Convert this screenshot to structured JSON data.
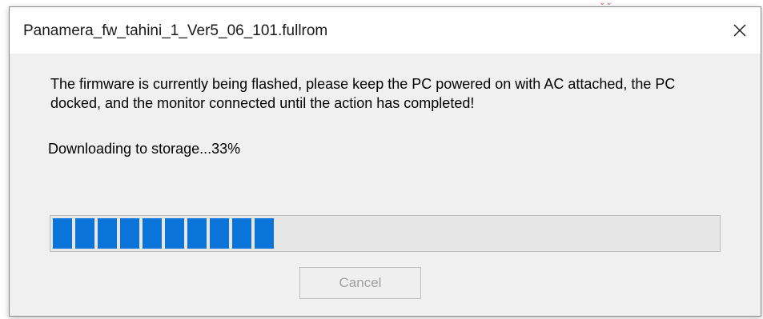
{
  "dialog": {
    "title": "Panamera_fw_tahini_1_Ver5_06_101.fullrom",
    "close_icon": "close-icon",
    "message": "The firmware is currently being flashed, please keep the PC powered on with AC attached, the PC docked, and the monitor connected until the action has completed!",
    "status": "Downloading to storage...33%",
    "progress_percent": 33,
    "cancel_label": "Cancel",
    "cancel_enabled": false
  },
  "colors": {
    "progress_fill": "#0a74d9",
    "dialog_background": "#f0f0f0",
    "titlebar_background": "#ffffff",
    "disabled_text": "#a0a0a0"
  }
}
